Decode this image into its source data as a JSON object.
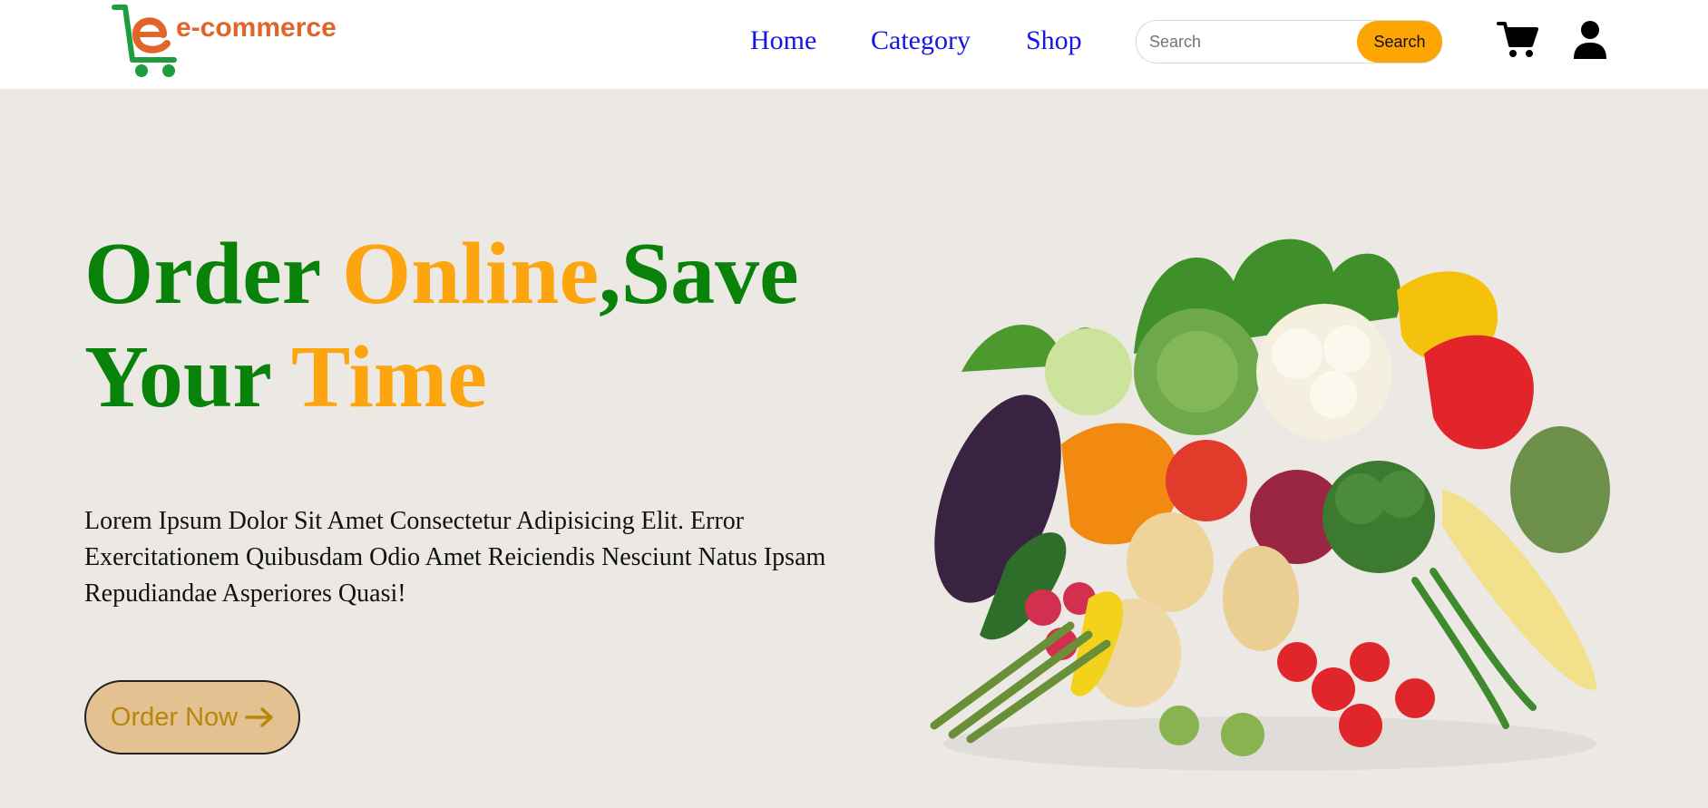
{
  "header": {
    "logo_text": "e-commerce",
    "nav": [
      {
        "label": "Home"
      },
      {
        "label": "Category"
      },
      {
        "label": "Shop"
      }
    ],
    "search": {
      "placeholder": "Search",
      "value": "",
      "button_label": "Search"
    },
    "icons": [
      "cart-icon",
      "user-icon"
    ]
  },
  "hero": {
    "title_line1_a": "Order",
    "title_line1_b": "Online",
    "title_line1_c": ",Save",
    "title_line2_a": "Your",
    "title_line2_b": "Time",
    "description": "Lorem Ipsum Dolor Sit Amet Consectetur Adipisicing Elit. Error Exercitationem Quibusdam Odio Amet Reiciendis Nesciunt Natus Ipsam Repudiandae Asperiores Quasi!",
    "cta_label": "Order Now"
  },
  "colors": {
    "green": "#098209",
    "orange": "#fca50f",
    "nav_link": "#1515e6",
    "search_button": "#fca503",
    "cta_bg": "#e4c190",
    "hero_bg": "#ece9e5"
  }
}
